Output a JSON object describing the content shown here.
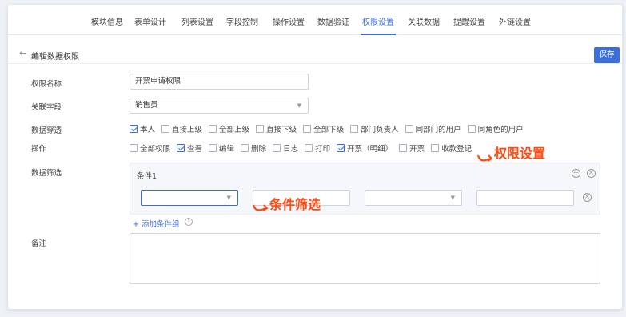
{
  "tabs": [
    {
      "label": "模块信息"
    },
    {
      "label": "表单设计"
    },
    {
      "label": "列表设置"
    },
    {
      "label": "字段控制"
    },
    {
      "label": "操作设置"
    },
    {
      "label": "数据验证"
    },
    {
      "label": "权限设置"
    },
    {
      "label": "关联数据"
    },
    {
      "label": "提醒设置"
    },
    {
      "label": "外链设置"
    }
  ],
  "active_tab": "权限设置",
  "header": {
    "back_icon": "arrow-left-icon",
    "title": "编辑数据权限",
    "save_label": "保存"
  },
  "form": {
    "name": {
      "label": "权限名称",
      "value": "开票申请权限"
    },
    "field": {
      "label": "关联字段",
      "value": "销售员"
    },
    "penetration": {
      "label": "数据穿透",
      "options": [
        {
          "label": "本人",
          "checked": true
        },
        {
          "label": "直接上级",
          "checked": false
        },
        {
          "label": "全部上级",
          "checked": false
        },
        {
          "label": "直接下级",
          "checked": false
        },
        {
          "label": "全部下级",
          "checked": false
        },
        {
          "label": "部门负责人",
          "checked": false
        },
        {
          "label": "同部门的用户",
          "checked": false
        },
        {
          "label": "同角色的用户",
          "checked": false
        }
      ]
    },
    "operations": {
      "label": "操作",
      "options": [
        {
          "label": "全部权限",
          "checked": false
        },
        {
          "label": "查看",
          "checked": true
        },
        {
          "label": "编辑",
          "checked": false
        },
        {
          "label": "删除",
          "checked": false
        },
        {
          "label": "日志",
          "checked": false
        },
        {
          "label": "打印",
          "checked": false
        },
        {
          "label": "开票（明细）",
          "checked": true
        },
        {
          "label": "开票",
          "checked": false
        },
        {
          "label": "收款登记",
          "checked": false
        }
      ]
    },
    "filter": {
      "label": "数据筛选",
      "condition_title": "条件1",
      "add_group_label": "+ 添加条件组"
    },
    "remark": {
      "label": "备注",
      "value": ""
    }
  },
  "annotations": {
    "permission": "权限设置",
    "filter": "条件筛选"
  },
  "colors": {
    "accent": "#3c6fd8",
    "annotation": "#ff4a12"
  }
}
